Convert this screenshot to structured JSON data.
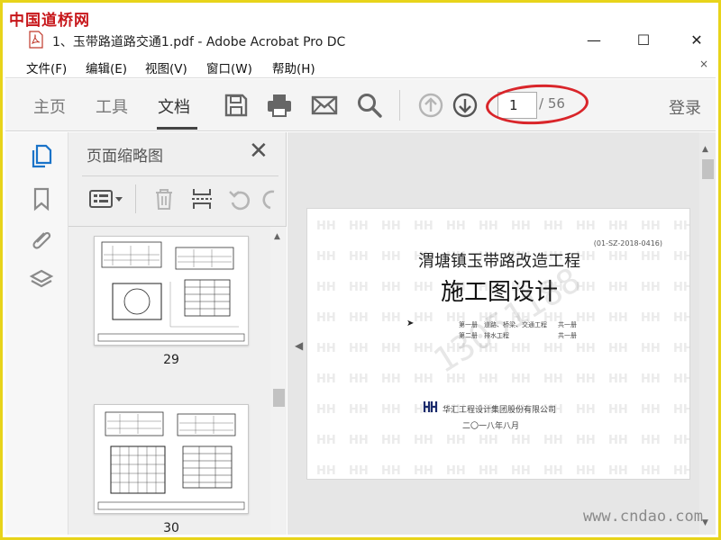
{
  "watermark": {
    "logo": "中国道桥网",
    "site": "www.cndao.com",
    "phone": "13051188"
  },
  "window": {
    "title": "1、玉带路道路交通1.pdf - Adobe Acrobat Pro DC",
    "controls": {
      "minimize": "—",
      "maximize": "☐",
      "close": "✕"
    }
  },
  "menu": {
    "items": [
      {
        "label": "文件(F)"
      },
      {
        "label": "编辑(E)"
      },
      {
        "label": "视图(V)"
      },
      {
        "label": "窗口(W)"
      },
      {
        "label": "帮助(H)"
      }
    ],
    "close_glyph": "×"
  },
  "toolbar": {
    "tabs": [
      {
        "label": "主页",
        "active": false
      },
      {
        "label": "工具",
        "active": false
      },
      {
        "label": "文档",
        "active": true
      }
    ],
    "icons": [
      "save-icon",
      "print-icon",
      "mail-icon",
      "search-icon",
      "page-up-icon",
      "page-down-icon"
    ],
    "page_current": "1",
    "page_total": "/ 56",
    "login": "登录",
    "highlight_color": "#d9252a"
  },
  "rail": {
    "icons": [
      "page-thumbnails-icon",
      "bookmark-icon",
      "attachment-icon",
      "layers-icon"
    ]
  },
  "panel": {
    "title": "页面缩略图",
    "close": "✕",
    "tools": [
      "options-menu-icon",
      "delete-icon",
      "extract-icon",
      "undo-icon",
      "redo-icon"
    ],
    "thumbnails": [
      {
        "page": "29"
      },
      {
        "page": "30"
      }
    ]
  },
  "document": {
    "code": "(01-SZ-2018-0416)",
    "title_line1": "渭塘镇玉带路改造工程",
    "title_line2": "施工图设计",
    "volumes": [
      {
        "vol": "第一册",
        "name": "道路、桥梁、交通工程",
        "count": "共一册"
      },
      {
        "vol": "第二册",
        "name": "排水工程",
        "count": "共一册"
      }
    ],
    "company": "华汇工程设计集团股份有限公司",
    "date": "二〇一八年八月",
    "bg_mark": "HH"
  }
}
